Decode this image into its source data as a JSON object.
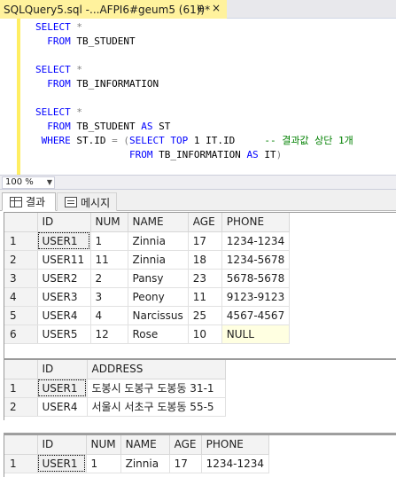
{
  "tab": {
    "title": "SQLQuery5.sql -...AFPI6#geum5 (61))*",
    "pin_glyph": "⊕",
    "close_glyph": "×"
  },
  "editor": {
    "lines": [
      [
        {
          "c": "kw",
          "t": "SELECT "
        },
        {
          "c": "op",
          "t": "*"
        }
      ],
      [
        {
          "c": "kw",
          "t": "  FROM "
        },
        {
          "c": "id",
          "t": "TB_STUDENT"
        }
      ],
      [],
      [
        {
          "c": "kw",
          "t": "SELECT "
        },
        {
          "c": "op",
          "t": "*"
        }
      ],
      [
        {
          "c": "kw",
          "t": "  FROM "
        },
        {
          "c": "id",
          "t": "TB_INFORMATION"
        }
      ],
      [],
      [
        {
          "c": "kw",
          "t": "SELECT "
        },
        {
          "c": "op",
          "t": "*"
        }
      ],
      [
        {
          "c": "kw",
          "t": "  FROM "
        },
        {
          "c": "id",
          "t": "TB_STUDENT "
        },
        {
          "c": "kw",
          "t": "AS "
        },
        {
          "c": "id",
          "t": "ST"
        }
      ],
      [
        {
          "c": "kw",
          "t": " WHERE "
        },
        {
          "c": "id",
          "t": "ST.ID "
        },
        {
          "c": "op",
          "t": "= ("
        },
        {
          "c": "kw",
          "t": "SELECT TOP "
        },
        {
          "c": "num",
          "t": "1 "
        },
        {
          "c": "id",
          "t": "IT.ID     "
        },
        {
          "c": "cm",
          "t": "-- 결과값 상단 1개"
        }
      ],
      [
        {
          "c": "id",
          "t": "                "
        },
        {
          "c": "kw",
          "t": "FROM "
        },
        {
          "c": "id",
          "t": "TB_INFORMATION "
        },
        {
          "c": "kw",
          "t": "AS "
        },
        {
          "c": "id",
          "t": "IT"
        },
        {
          "c": "op",
          "t": ")"
        }
      ]
    ]
  },
  "zoom": {
    "value": "100 %"
  },
  "result_tabs": {
    "results_label": "결과",
    "messages_label": "메시지"
  },
  "grid1": {
    "columns": [
      "ID",
      "NUM",
      "NAME",
      "AGE",
      "PHONE"
    ],
    "rows": [
      [
        "1",
        "USER1",
        "1",
        "Zinnia",
        "17",
        "1234-1234"
      ],
      [
        "2",
        "USER11",
        "11",
        "Zinnia",
        "18",
        "1234-5678"
      ],
      [
        "3",
        "USER2",
        "2",
        "Pansy",
        "23",
        "5678-5678"
      ],
      [
        "4",
        "USER3",
        "3",
        "Peony",
        "11",
        "9123-9123"
      ],
      [
        "5",
        "USER4",
        "4",
        "Narcissus",
        "25",
        "4567-4567"
      ],
      [
        "6",
        "USER5",
        "12",
        "Rose",
        "10",
        "NULL"
      ]
    ]
  },
  "grid2": {
    "columns": [
      "ID",
      "ADDRESS"
    ],
    "rows": [
      [
        "1",
        "USER1",
        "도봉시 도봉구 도봉동 31-1"
      ],
      [
        "2",
        "USER4",
        "서울시 서초구 도봉동 55-5"
      ]
    ]
  },
  "grid3": {
    "columns": [
      "ID",
      "NUM",
      "NAME",
      "AGE",
      "PHONE"
    ],
    "rows": [
      [
        "1",
        "USER1",
        "1",
        "Zinnia",
        "17",
        "1234-1234"
      ]
    ]
  },
  "colors": {
    "tab_active": "#fff29d",
    "change_bar": "#ffee62",
    "keyword": "#0000ff",
    "comment": "#008000"
  }
}
